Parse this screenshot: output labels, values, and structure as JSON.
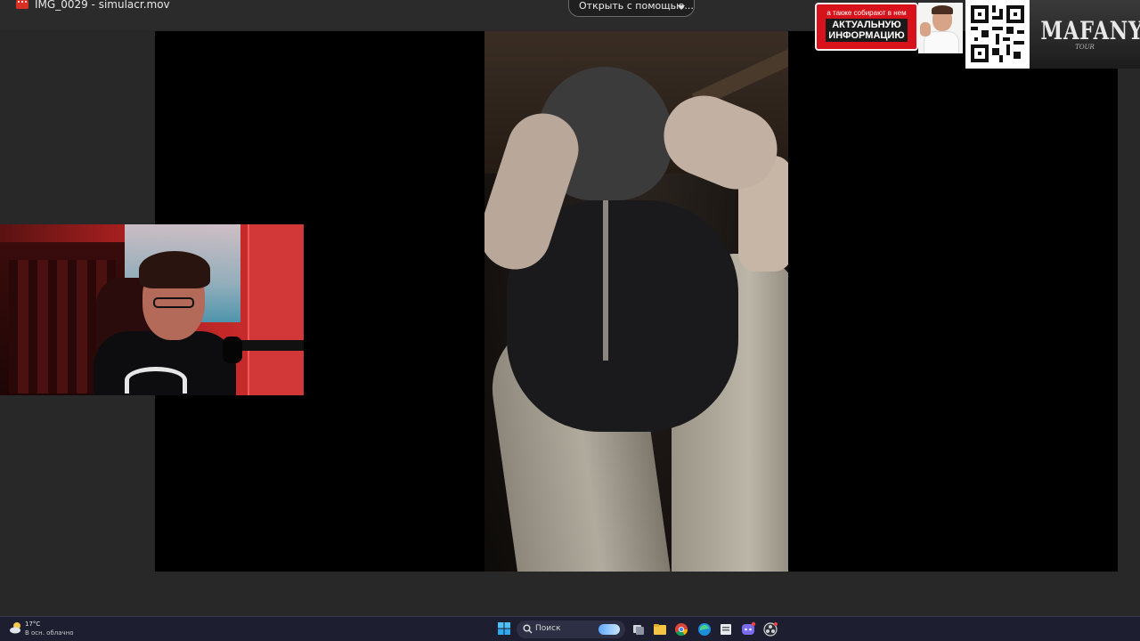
{
  "window": {
    "file_title": "IMG_0029 - simulacr.mov",
    "open_with_label": "Открыть с помощью..."
  },
  "overlay_ad": {
    "tagline": "а также собирают в нем",
    "headline_1": "АКТУАЛЬНУЮ",
    "headline_2": "ИНФОРМАЦИЮ",
    "tour_title": "MAFANYA",
    "tour_sub": "TOUR",
    "accent_color": "#d8121a"
  },
  "taskbar": {
    "weather_temp": "17°C",
    "weather_desc": "В осн. облачно",
    "search_placeholder": "Поиск",
    "apps": [
      {
        "name": "task-view-icon"
      },
      {
        "name": "file-explorer-icon"
      },
      {
        "name": "chrome-icon"
      },
      {
        "name": "edge-icon"
      },
      {
        "name": "app-window-icon"
      },
      {
        "name": "discord-icon"
      },
      {
        "name": "obs-icon"
      }
    ]
  }
}
